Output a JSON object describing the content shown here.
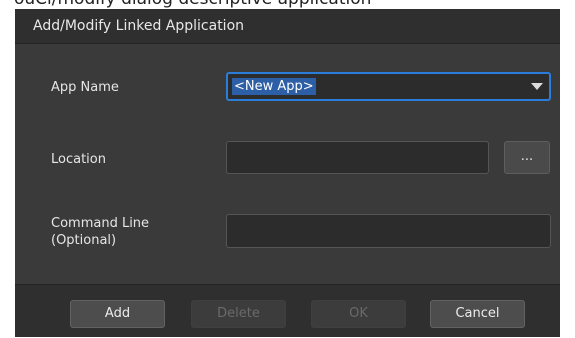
{
  "background_caption": "ouCl/modify dialog descriptive application",
  "dialog": {
    "title": "Add/Modify Linked Application",
    "accent_color": "#2a7dd8"
  },
  "form": {
    "app_name_label": "App Name",
    "app_name_value": "<New App>",
    "location_label": "Location",
    "location_value": "",
    "browse_label": "...",
    "command_label_line1": "Command Line",
    "command_label_line2": "(Optional)",
    "command_value": ""
  },
  "buttons": {
    "add": "Add",
    "delete": "Delete",
    "ok": "OK",
    "cancel": "Cancel"
  },
  "icons": {
    "dropdown": "chevron-down-icon"
  }
}
